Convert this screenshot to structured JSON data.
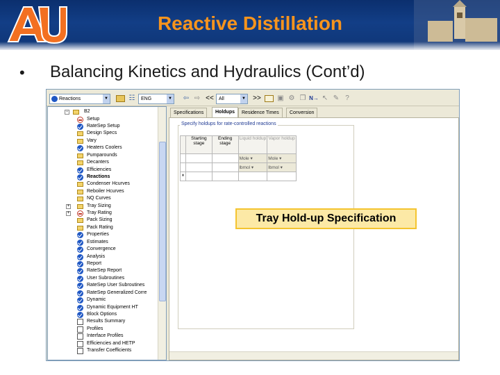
{
  "slide": {
    "title": "Reactive Distillation",
    "bullet_symbol": "•",
    "heading": "Balancing Kinetics and Hydraulics (Cont’d)",
    "callout": "Tray Hold-up Specification",
    "colors": {
      "banner": "#123e86",
      "title": "#f7941d",
      "callout_bg": "#fce9a6",
      "callout_border": "#f4c430"
    }
  },
  "app": {
    "toolbar": {
      "object_combo": "Reactions",
      "units_combo": "ENG",
      "nav_combo": "All",
      "forward_label": ">>",
      "back_label": "<<",
      "next_label": "N→"
    },
    "tree": {
      "root_label": "B2",
      "items": [
        {
          "label": "Setup",
          "icon": "red-circle-icon"
        },
        {
          "label": "RateSep Setup",
          "icon": "check-icon"
        },
        {
          "label": "Design Specs",
          "icon": "folder-icon"
        },
        {
          "label": "Vary",
          "icon": "folder-icon"
        },
        {
          "label": "Heaters Coolers",
          "icon": "check-icon"
        },
        {
          "label": "Pumparounds",
          "icon": "folder-icon"
        },
        {
          "label": "Decanters",
          "icon": "folder-icon"
        },
        {
          "label": "Efficiencies",
          "icon": "check-icon"
        },
        {
          "label": "Reactions",
          "icon": "check-icon"
        },
        {
          "label": "Condenser Hcurves",
          "icon": "folder-icon"
        },
        {
          "label": "Reboiler Hcurves",
          "icon": "folder-icon"
        },
        {
          "label": "NQ Curves",
          "icon": "folder-icon"
        },
        {
          "label": "Tray Sizing",
          "icon": "folder-icon"
        },
        {
          "label": "Tray Rating",
          "icon": "red-circle-icon"
        },
        {
          "label": "Pack Sizing",
          "icon": "folder-icon"
        },
        {
          "label": "Pack Rating",
          "icon": "folder-icon"
        },
        {
          "label": "Properties",
          "icon": "check-icon"
        },
        {
          "label": "Estimates",
          "icon": "check-icon"
        },
        {
          "label": "Convergence",
          "icon": "check-icon"
        },
        {
          "label": "Analysis",
          "icon": "check-icon"
        },
        {
          "label": "Report",
          "icon": "check-icon"
        },
        {
          "label": "RateSep Report",
          "icon": "check-icon"
        },
        {
          "label": "User Subroutines",
          "icon": "check-icon"
        },
        {
          "label": "RateSep User Subroutines",
          "icon": "check-icon"
        },
        {
          "label": "RateSep Generalized Corre",
          "icon": "check-icon"
        },
        {
          "label": "Dynamic",
          "icon": "check-icon"
        },
        {
          "label": "Dynamic Equipment HT",
          "icon": "check-icon"
        },
        {
          "label": "Block Options",
          "icon": "check-icon"
        },
        {
          "label": "Results Summary",
          "icon": "empty-box-icon"
        },
        {
          "label": "Profiles",
          "icon": "empty-box-icon"
        },
        {
          "label": "Interface Profiles",
          "icon": "empty-box-icon"
        },
        {
          "label": "Efficiencies and HETP",
          "icon": "empty-box-icon"
        },
        {
          "label": "Transfer Coefficients",
          "icon": "empty-box-icon"
        }
      ]
    },
    "tabs": [
      {
        "label": "Specifications",
        "active": false
      },
      {
        "label": "Holdups",
        "active": true
      },
      {
        "label": "Residence Times",
        "active": false
      },
      {
        "label": "Conversion",
        "active": false
      }
    ],
    "holdups": {
      "group_label": "Specify holdups for rate-controlled reactions",
      "columns": [
        "Starting stage",
        "Ending stage",
        "Liquid holdup",
        "Vapor holdup"
      ],
      "basis_row": [
        "Mole",
        "Mole"
      ],
      "units_row": [
        "lbmol",
        "lbmol"
      ],
      "new_row_marker": "*"
    }
  }
}
